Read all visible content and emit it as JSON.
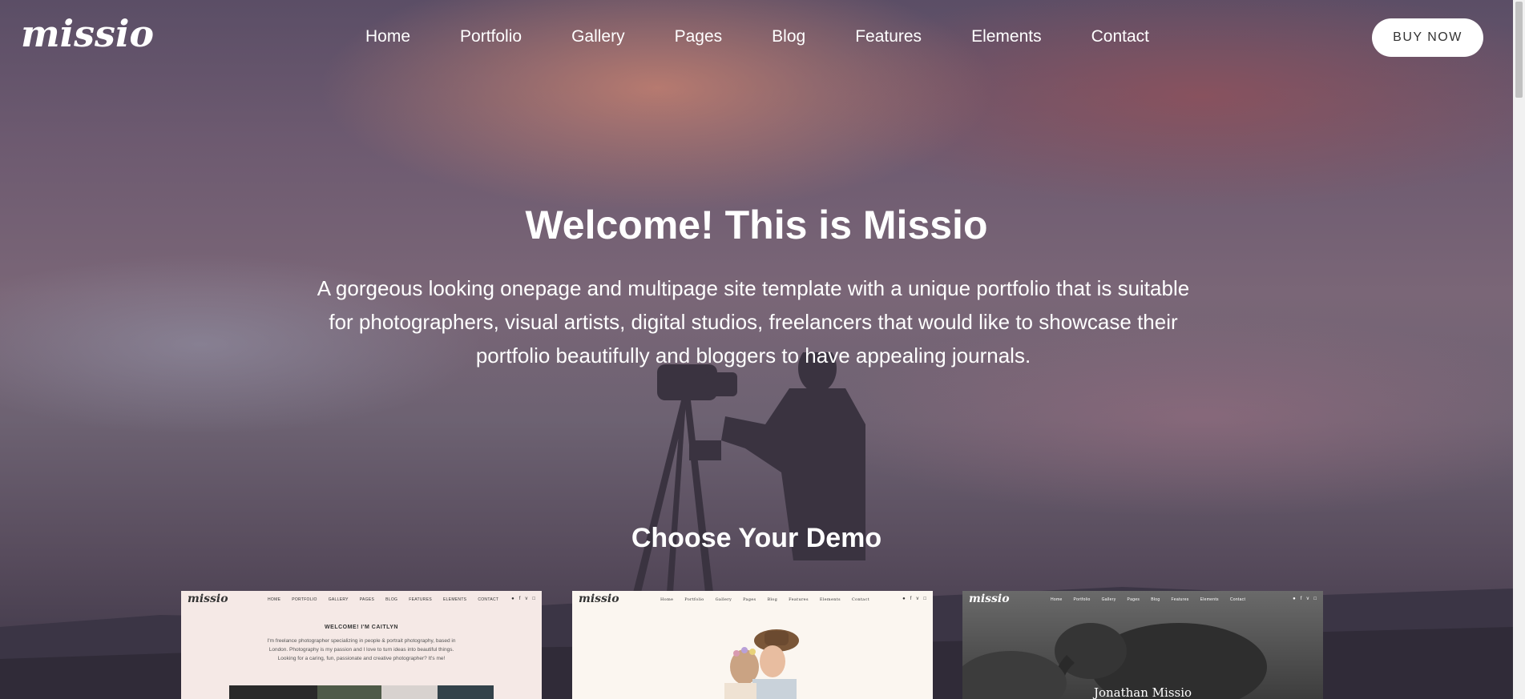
{
  "brand": {
    "logo_text": "missio"
  },
  "nav": {
    "items": [
      "Home",
      "Portfolio",
      "Gallery",
      "Pages",
      "Blog",
      "Features",
      "Elements",
      "Contact"
    ],
    "buy_label": "BUY NOW"
  },
  "hero": {
    "title": "Welcome! This is Missio",
    "description_lines": [
      "A gorgeous looking onepage and multipage site template with a unique portfolio that is suitable",
      "for photographers, visual artists, digital studios, freelancers that would like to showcase their",
      "portfolio beautifully and bloggers to have appealing journals."
    ]
  },
  "demos": {
    "title": "Choose Your Demo",
    "cards": [
      {
        "logo": "missio",
        "menu": [
          "HOME",
          "PORTFOLIO",
          "GALLERY",
          "PAGES",
          "BLOG",
          "FEATURES",
          "ELEMENTS",
          "CONTACT"
        ],
        "heading": "WELCOME! I'M CAITLYN",
        "text_lines": [
          "I'm freelance photographer specializing in people & portrait photography, based in",
          "London. Photography is my passion and I love to turn ideas into beautiful things.",
          "Looking for a caring, fun, passionate and creative photographer? It's me!"
        ]
      },
      {
        "logo": "missio",
        "menu": [
          "Home",
          "Portfolio",
          "Gallery",
          "Pages",
          "Blog",
          "Features",
          "Elements",
          "Contact"
        ]
      },
      {
        "logo": "missio",
        "menu": [
          "Home",
          "Portfolio",
          "Gallery",
          "Pages",
          "Blog",
          "Features",
          "Elements",
          "Contact"
        ],
        "name": "Jonathan Missio"
      }
    ]
  },
  "social_icons": [
    "twitter-icon",
    "facebook-icon",
    "vimeo-icon",
    "instagram-icon"
  ],
  "colors": {
    "button_bg": "#ffffff",
    "button_text": "#333333",
    "card1_bg": "#f5e9e6"
  }
}
